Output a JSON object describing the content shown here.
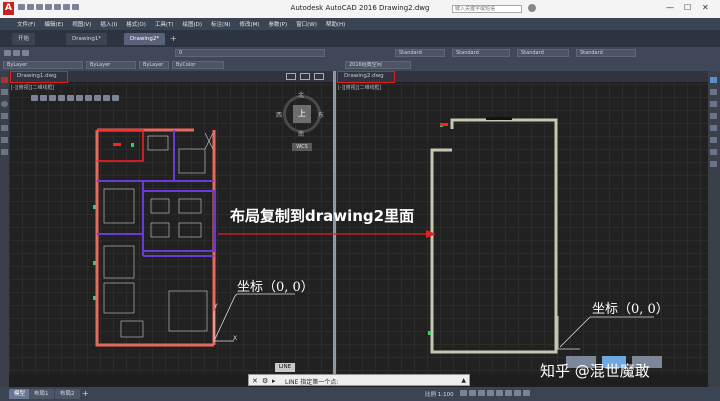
{
  "titlebar": {
    "title": "Autodesk AutoCAD 2016    Drawing2.dwg",
    "search_placeholder": "键入关键字或短语"
  },
  "menubar": {
    "items": [
      "文件(F)",
      "编辑(E)",
      "视图(V)",
      "插入(I)",
      "格式(O)",
      "工具(T)",
      "绘图(D)",
      "标注(N)",
      "修改(M)",
      "参数(P)",
      "窗口(W)",
      "帮助(H)"
    ]
  },
  "tabs": {
    "start": "开始",
    "drawing1": "Drawing1*",
    "drawing2": "Drawing2*"
  },
  "ribbon": {
    "layer_combo": "0",
    "style1": "Standard",
    "style2": "Standard",
    "style3": "Standard",
    "style4": "Standard",
    "bylayer1": "ByLayer",
    "bylayer2": "ByLayer",
    "bylayer3": "ByLayer",
    "bycolor": "ByColor",
    "workspace": "2016经典空间"
  },
  "pane1": {
    "doc_title": "Drawing1.dwg",
    "view_tag": "[-][俯视][二维线框]",
    "viewcube": {
      "north": "北",
      "south": "南",
      "east": "东",
      "west": "西",
      "top": "上",
      "wcs": "WCS"
    }
  },
  "pane2": {
    "doc_title": "Drawing2.dwg",
    "view_tag": "[-][俯视][二维线框]"
  },
  "annotations": {
    "copy_text": "布局复制到drawing2里面",
    "coord1": "坐标（0, 0）",
    "coord2": "坐标（0, 0）",
    "axis_y": "Y",
    "axis_x": "X"
  },
  "command": {
    "label": "LINE",
    "prompt": "LINE 指定第一个点:"
  },
  "statusbar": {
    "model_tab": "模型",
    "layout1": "布局1",
    "layout2": "布局2",
    "scale": "比例 1:100"
  },
  "watermark": "知乎 @混世魔敢",
  "colors": {
    "menubar": "#3b4453",
    "highlight_red": "#e0201c",
    "wall_salmon": "#e86a5c",
    "partition_purple": "#6a3bd8",
    "wall_grey": "#c9c6b0"
  }
}
